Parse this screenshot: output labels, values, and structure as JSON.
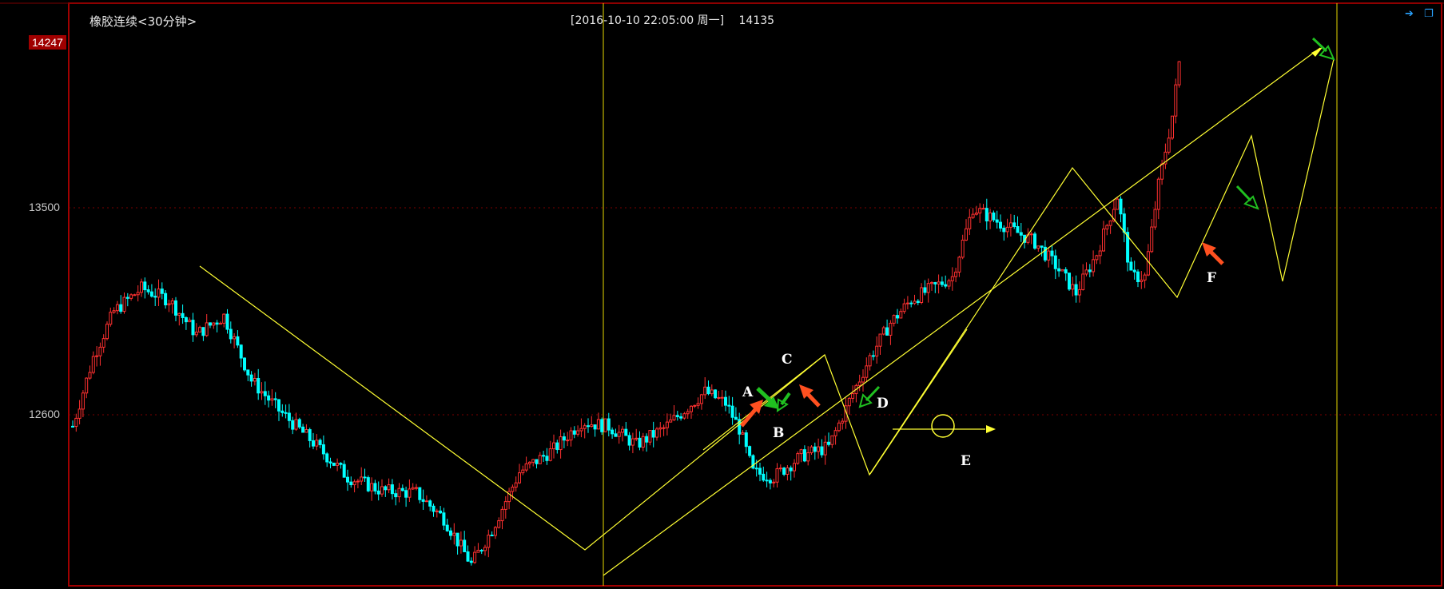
{
  "title": "橡胶连续<30分钟>",
  "info": {
    "datetime": "[2016-10-10  22:05:00 周一]",
    "value": "14135"
  },
  "current_price": "14247",
  "chart_data": {
    "type": "candlestick",
    "ylim": [
      11750,
      14300
    ],
    "y_ticks": [
      12600,
      13500
    ],
    "up_color": "#ff3030",
    "down_color": "#00ffff",
    "line_color": "#ffff00",
    "waypoints": [
      [
        0,
        12550
      ],
      [
        6,
        12850
      ],
      [
        12,
        13050
      ],
      [
        20,
        13150
      ],
      [
        28,
        13100
      ],
      [
        36,
        12950
      ],
      [
        44,
        13030
      ],
      [
        52,
        12750
      ],
      [
        60,
        12620
      ],
      [
        70,
        12480
      ],
      [
        80,
        12330
      ],
      [
        90,
        12270
      ],
      [
        100,
        12260
      ],
      [
        108,
        12150
      ],
      [
        116,
        11950
      ],
      [
        122,
        12100
      ],
      [
        130,
        12350
      ],
      [
        140,
        12450
      ],
      [
        148,
        12570
      ],
      [
        156,
        12550
      ],
      [
        164,
        12470
      ],
      [
        172,
        12540
      ],
      [
        178,
        12620
      ],
      [
        184,
        12700
      ],
      [
        190,
        12650
      ],
      [
        194,
        12540
      ],
      [
        198,
        12350
      ],
      [
        204,
        12330
      ],
      [
        212,
        12420
      ],
      [
        220,
        12460
      ],
      [
        226,
        12660
      ],
      [
        232,
        12850
      ],
      [
        238,
        13000
      ],
      [
        244,
        13100
      ],
      [
        250,
        13150
      ],
      [
        256,
        13200
      ],
      [
        262,
        13500
      ],
      [
        268,
        13450
      ],
      [
        274,
        13400
      ],
      [
        280,
        13350
      ],
      [
        286,
        13250
      ],
      [
        292,
        13130
      ],
      [
        298,
        13300
      ],
      [
        304,
        13550
      ],
      [
        308,
        13200
      ],
      [
        312,
        13200
      ],
      [
        316,
        13600
      ],
      [
        320,
        13900
      ],
      [
        322,
        14130
      ]
    ],
    "annotations": [
      {
        "label": "A"
      },
      {
        "label": "B"
      },
      {
        "label": "C"
      },
      {
        "label": "D"
      },
      {
        "label": "E"
      },
      {
        "label": "F"
      }
    ]
  }
}
